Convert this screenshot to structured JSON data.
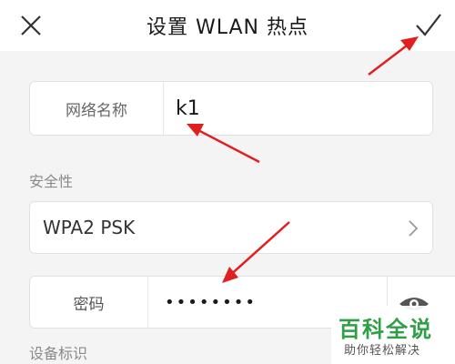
{
  "header": {
    "title": "设置 WLAN 热点",
    "close_icon": "close-icon",
    "confirm_icon": "checkmark-icon"
  },
  "ssid": {
    "label": "网络名称",
    "value": "k1"
  },
  "security": {
    "section_label": "安全性",
    "value": "WPA2 PSK",
    "chevron_icon": "chevron-right-icon"
  },
  "password": {
    "label": "密码",
    "value": "••••••••",
    "eye_icon": "eye-icon"
  },
  "device": {
    "section_label": "设备标识"
  },
  "watermark": {
    "title": "百科全说",
    "subtitle": "助你轻松解决"
  },
  "colors": {
    "accent_arrow": "#e02020",
    "watermark_green": "#2f9e44"
  }
}
